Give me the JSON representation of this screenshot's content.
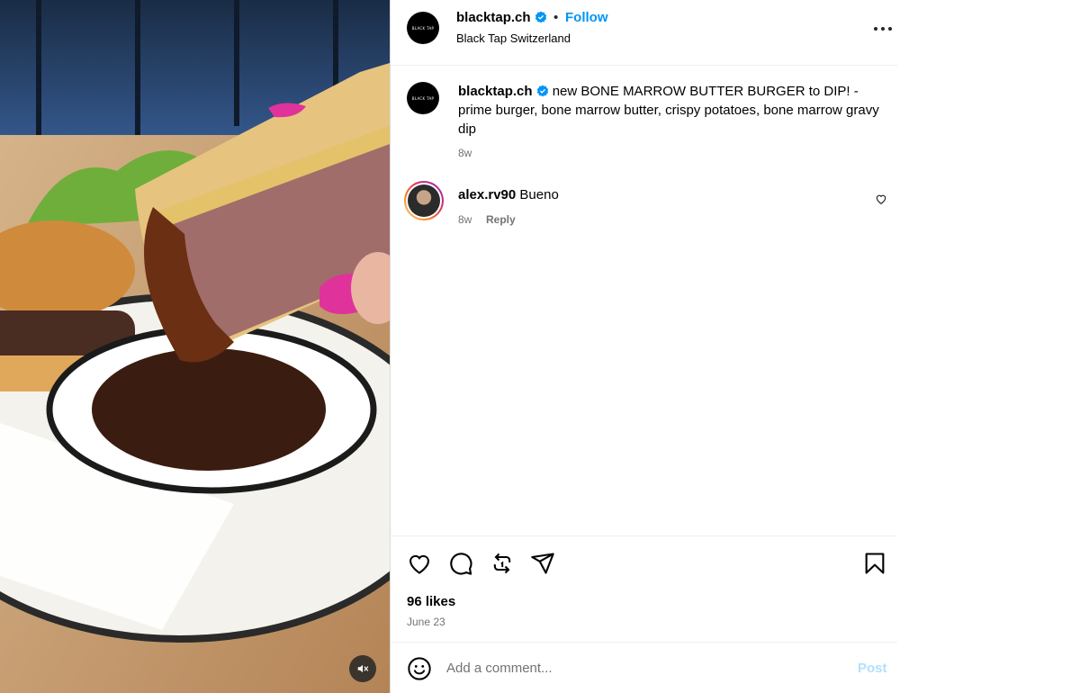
{
  "post": {
    "account": "blacktap.ch",
    "follow_label": "Follow",
    "separator": "•",
    "location": "Black Tap Switzerland",
    "logo_text": "BLACK TAP",
    "caption": "new BONE MARROW BUTTER BURGER to DIP! - prime burger, bone marrow butter, crispy potatoes, bone marrow gravy dip",
    "caption_age": "8w"
  },
  "comments": [
    {
      "user": "alex.rv90",
      "text": "Bueno",
      "age": "8w",
      "reply_label": "Reply"
    }
  ],
  "actions": {
    "likes": "96 likes",
    "date": "June 23"
  },
  "comment_box": {
    "placeholder": "Add a comment...",
    "post_label": "Post"
  },
  "icons": {
    "verified": "verified-badge-icon",
    "more": "more-options-icon",
    "like": "heart-icon",
    "comment": "comment-icon",
    "repost": "repost-icon",
    "share": "send-icon",
    "save": "bookmark-icon",
    "emoji": "emoji-icon",
    "mute": "speaker-muted-icon"
  },
  "colors": {
    "link": "#0095f6",
    "verified": "#0095f6",
    "post_disabled": "#b2dffc",
    "muted_text": "#737373"
  }
}
